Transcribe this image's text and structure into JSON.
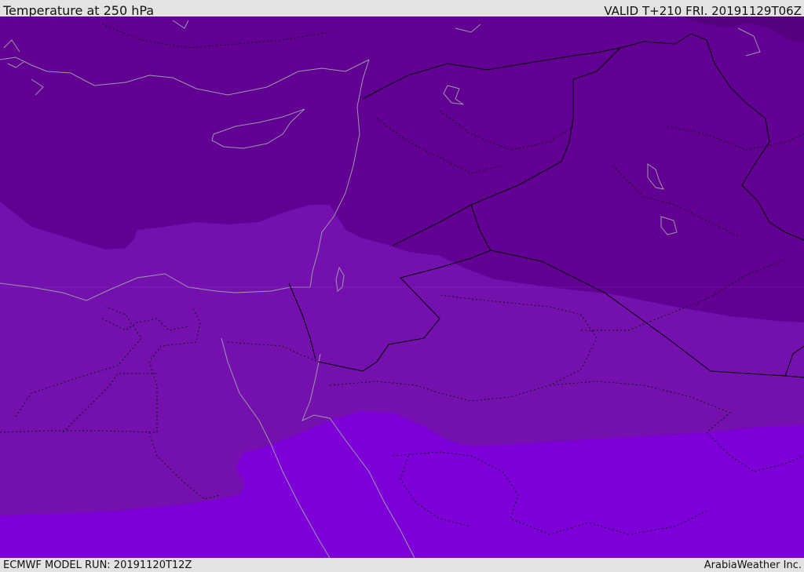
{
  "header": {
    "title": "Temperature at 250 hPa",
    "valid": "VALID T+210 FRI. 20191129T06Z"
  },
  "footer": {
    "model_run": "ECMWF MODEL RUN: 20191120T12Z",
    "credit": "ArabiaWeather Inc."
  },
  "map": {
    "colors": {
      "band_cold": "#630094",
      "band_mid": "#7410ad",
      "band_warm": "#7d00d9",
      "band_dark_corner": "#55007e",
      "coastline": "#9a9aa6",
      "border": "#000000"
    }
  }
}
